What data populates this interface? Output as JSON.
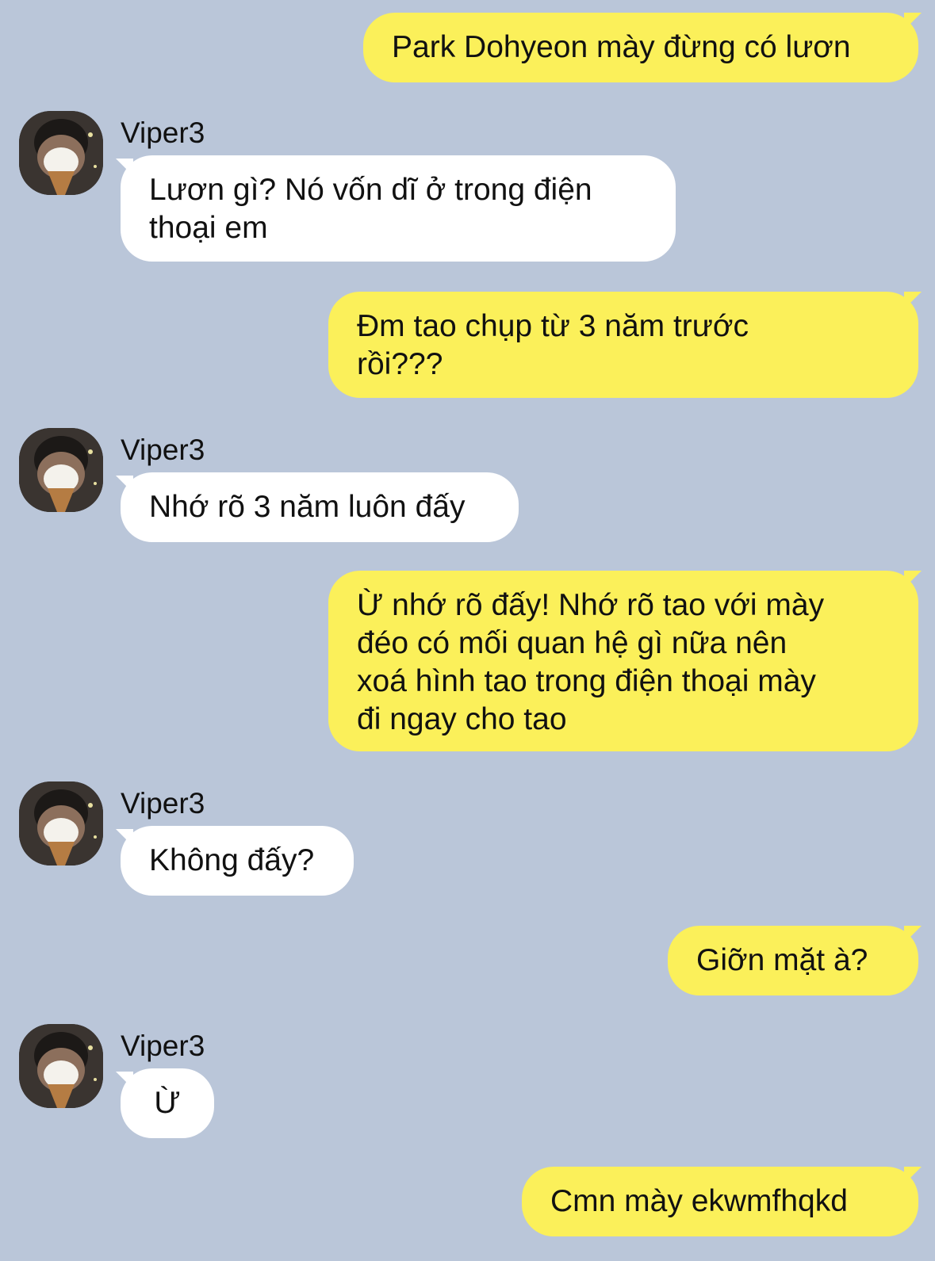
{
  "colors": {
    "background": "#bac6d9",
    "outgoing_bubble": "#fbf05a",
    "incoming_bubble": "#ffffff"
  },
  "messages": [
    {
      "direction": "out",
      "text": "Park Dohyeon mày đừng có lươn"
    },
    {
      "direction": "in",
      "sender": "Viper3",
      "text": "Lươn gì? Nó vốn dĩ ở trong điện\nthoại em"
    },
    {
      "direction": "out",
      "text": "Đm tao chụp từ 3 năm trước\nrồi???"
    },
    {
      "direction": "in",
      "sender": "Viper3",
      "text": "Nhớ rõ 3 năm luôn đấy"
    },
    {
      "direction": "out",
      "text": "Ừ nhớ rõ đấy! Nhớ rõ tao với mày\nđéo có mối quan hệ gì nữa nên\nxoá hình tao trong điện thoại mày\nđi ngay cho tao"
    },
    {
      "direction": "in",
      "sender": "Viper3",
      "text": "Không đấy?"
    },
    {
      "direction": "out",
      "text": "Giỡn mặt à?"
    },
    {
      "direction": "in",
      "sender": "Viper3",
      "text": "Ừ"
    },
    {
      "direction": "out",
      "text": "Cmn mày ekwmfhqkd"
    }
  ],
  "icons": {
    "avatar": "avatar-photo-icon"
  }
}
